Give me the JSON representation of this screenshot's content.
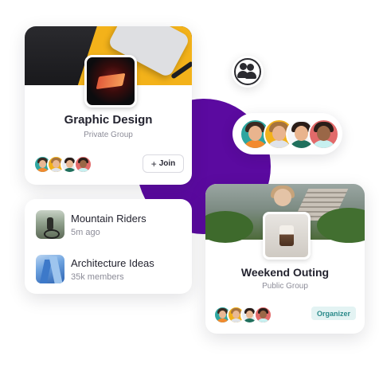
{
  "graphic_design_card": {
    "title": "Graphic Design",
    "subtitle": "Private Group",
    "join_label": "Join",
    "join_icon": "plus-icon",
    "member_count_shown": 4
  },
  "groups_list": {
    "items": [
      {
        "name": "Mountain Riders",
        "meta": "5m ago",
        "thumb": "cyclist-photo"
      },
      {
        "name": "Architecture Ideas",
        "meta": "35k members",
        "thumb": "building-photo"
      }
    ]
  },
  "people_icon": "people-icon",
  "member_pill": {
    "avatar_count": 4,
    "colors": [
      "#2fa6a0",
      "#f2b11b",
      "#ffffff",
      "#e26a6a"
    ]
  },
  "weekend_card": {
    "title": "Weekend Outing",
    "subtitle": "Public Group",
    "badge": "Organizer",
    "member_count_shown": 4
  },
  "colors": {
    "accent_purple": "#5b0aa0",
    "badge_bg": "#e3f3f3",
    "badge_text": "#2a8a8a"
  }
}
